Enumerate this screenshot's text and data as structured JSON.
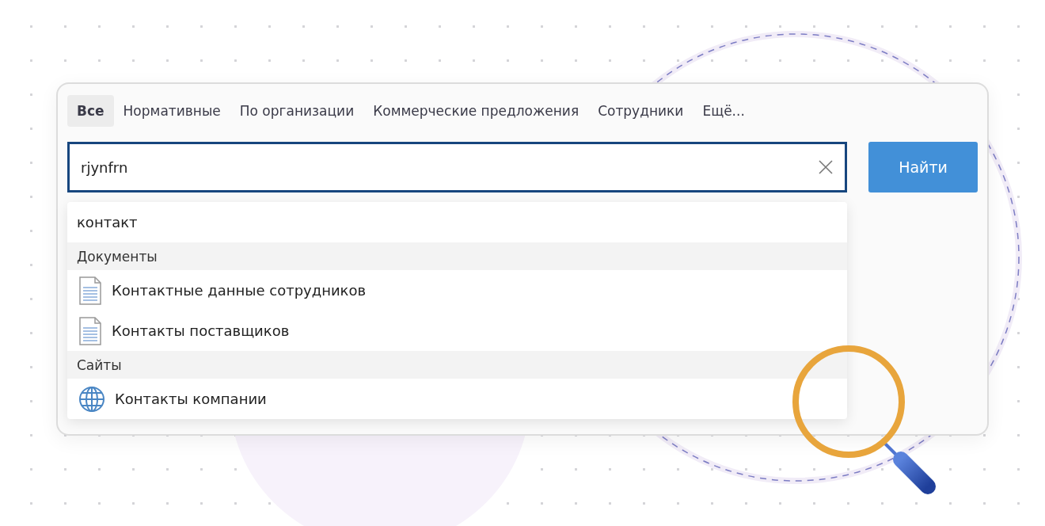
{
  "tabs": [
    {
      "label": "Все",
      "selected": true
    },
    {
      "label": "Нормативные",
      "selected": false
    },
    {
      "label": "По организации",
      "selected": false
    },
    {
      "label": "Коммерческие предложения",
      "selected": false
    },
    {
      "label": "Сотрудники",
      "selected": false
    },
    {
      "label": "Ещё...",
      "selected": false
    }
  ],
  "search": {
    "value": "rjynfrn"
  },
  "search_button": "Найти",
  "dropdown": {
    "suggestion": "контакт",
    "groups": [
      {
        "title": "Документы",
        "items": [
          {
            "kind": "document",
            "label": "Контактные данные сотрудников"
          },
          {
            "kind": "document",
            "label": "Контакты поставщиков"
          }
        ]
      },
      {
        "title": "Сайты",
        "items": [
          {
            "kind": "site",
            "label": "Контакты компании"
          }
        ]
      }
    ]
  }
}
